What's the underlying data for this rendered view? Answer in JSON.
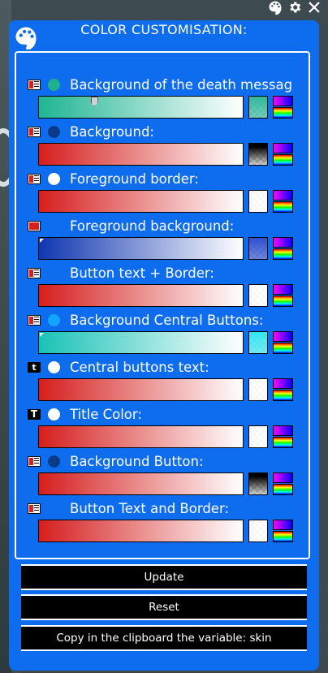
{
  "topbar": {
    "palette_icon": "palette-icon",
    "gear_icon": "gear-icon",
    "close_icon": "close-icon"
  },
  "panel": {
    "title": "COLOR CUSTOMISATION:"
  },
  "rows": [
    {
      "label": "Background of the death message",
      "type_icon": "bar-lines",
      "dot_color": "#21b08f",
      "gradient": [
        "#1fb592",
        "#ffffff"
      ],
      "swatch": "#2fb89a",
      "thumb_value": 0.27
    },
    {
      "label": "Background:",
      "type_icon": "bar-lines",
      "dot_color": "#0b3a8a",
      "gradient": [
        "#d61e1e",
        "#ffffff"
      ],
      "swatch": "#000000",
      "thumb_value": 1.0
    },
    {
      "label": "Foreground border:",
      "type_icon": "bar-lines",
      "dot_color": "#ffffff",
      "gradient": [
        "#d61e1e",
        "#ffffff"
      ],
      "swatch": "#ffffff",
      "thumb_value": 1.0
    },
    {
      "label": "Foreground background:",
      "type_icon": "bar-solid",
      "dot_color": "none",
      "gradient": [
        "#1036b0",
        "#ffffff"
      ],
      "swatch": "#2d4fd0",
      "thumb_value": 0.0
    },
    {
      "label": "Button text + Border:",
      "type_icon": "bar-lines",
      "dot_color": "none",
      "gradient": [
        "#d61e1e",
        "#ffffff"
      ],
      "swatch": "#ffffff",
      "thumb_value": 1.0
    },
    {
      "label": "Background Central Buttons:",
      "type_icon": "bar-lines",
      "dot_color": "#12a5ff",
      "gradient": [
        "#19c2b6",
        "#ffffff"
      ],
      "swatch": "#32e6f0",
      "thumb_value": 0.0
    },
    {
      "label": "Central buttons text:",
      "type_icon": "t",
      "dot_color": "#ffffff",
      "gradient": [
        "#d61e1e",
        "#ffffff"
      ],
      "swatch": "#ffffff",
      "thumb_value": 1.0
    },
    {
      "label": "Title Color:",
      "type_icon": "T",
      "dot_color": "#ffffff",
      "gradient": [
        "#d61e1e",
        "#ffffff"
      ],
      "swatch": "#ffffff",
      "thumb_value": 1.0
    },
    {
      "label": "Background Button:",
      "type_icon": "bar-lines",
      "dot_color": "#0b3a8a",
      "gradient": [
        "#d61e1e",
        "#ffffff"
      ],
      "swatch": "#000000",
      "thumb_value": 1.0
    },
    {
      "label": "Button Text and Border:",
      "type_icon": "bar-lines",
      "dot_color": "none",
      "gradient": [
        "#d61e1e",
        "#ffffff"
      ],
      "swatch": "#ffffff",
      "thumb_value": 1.0
    }
  ],
  "buttons": {
    "update": "Update",
    "reset": "Reset",
    "copy": "Copy in the clipboard the variable: skin"
  },
  "colors": {
    "panel": "#0d6dee",
    "button_bg": "#000000",
    "text": "#ffffff"
  }
}
